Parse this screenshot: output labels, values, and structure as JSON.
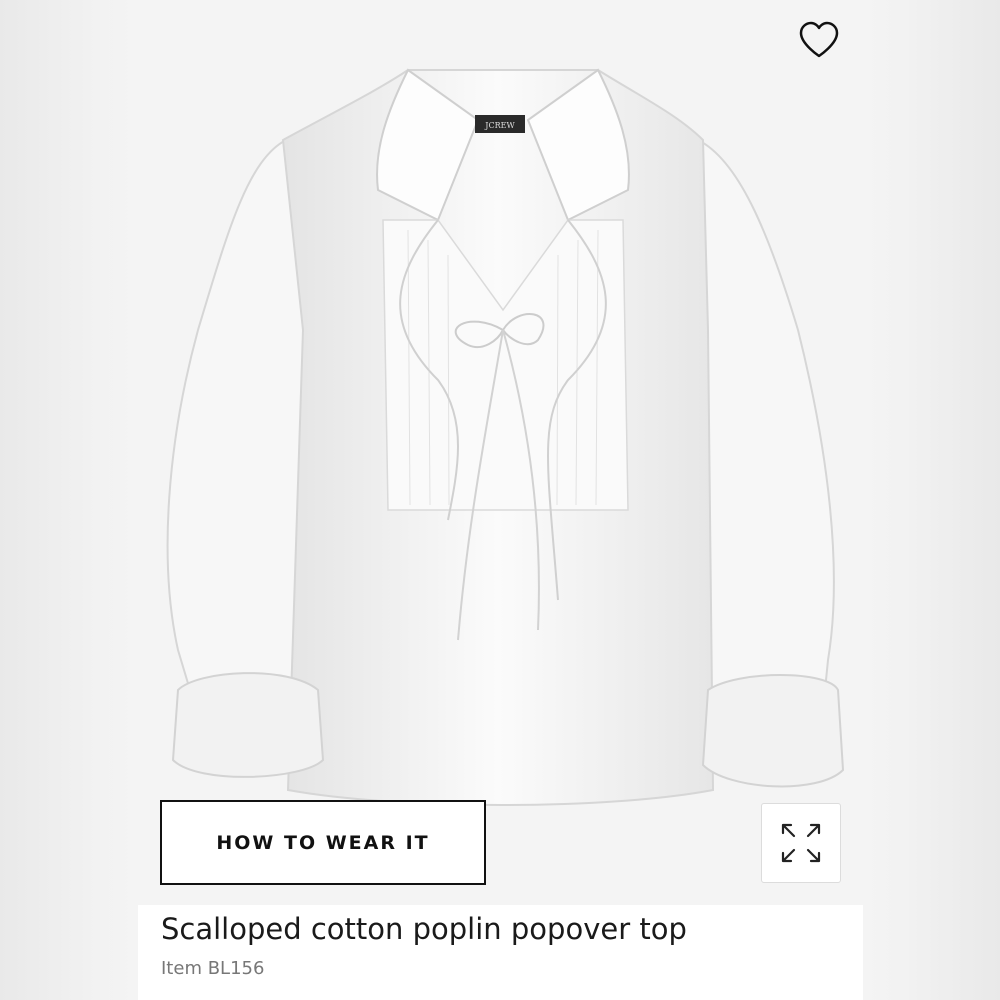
{
  "product": {
    "title": "Scalloped cotton poplin popover top",
    "item_id": "Item BL156",
    "brand_label": "JCREW"
  },
  "actions": {
    "how_to_wear_label": "HOW TO WEAR IT"
  },
  "icons": {
    "favorite": "heart-outline-icon",
    "expand": "expand-arrows-icon"
  },
  "colors": {
    "button_border": "#111111",
    "title_text": "#1a1a1a",
    "item_text": "#777777"
  }
}
